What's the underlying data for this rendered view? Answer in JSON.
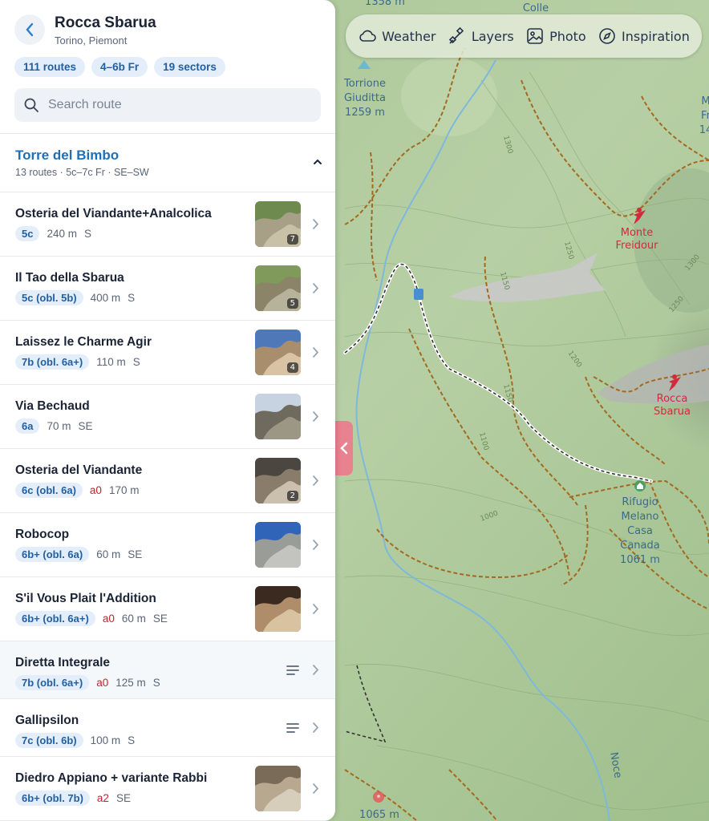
{
  "crag": {
    "title": "Rocca Sbarua",
    "location": "Torino, Piemont",
    "chips": [
      "111 routes",
      "4–6b Fr",
      "19 sectors"
    ]
  },
  "search": {
    "placeholder": "Search route"
  },
  "sector": {
    "title": "Torre del Bimbo",
    "meta": "13 routes · 5c–7c Fr · SE–SW"
  },
  "routes": [
    {
      "name": "Osteria del Viandante+Analcolica",
      "grade": "5c",
      "aid": "",
      "length": "240 m",
      "aspect": "S",
      "photos": "7",
      "kind": "photo"
    },
    {
      "name": "Il Tao della Sbarua",
      "grade": "5c (obl. 5b)",
      "aid": "",
      "length": "400 m",
      "aspect": "S",
      "photos": "5",
      "kind": "photo"
    },
    {
      "name": "Laissez le Charme Agir",
      "grade": "7b (obl. 6a+)",
      "aid": "",
      "length": "110 m",
      "aspect": "S",
      "photos": "4",
      "kind": "photo"
    },
    {
      "name": "Via Bechaud",
      "grade": "6a",
      "aid": "",
      "length": "70 m",
      "aspect": "SE",
      "photos": "",
      "kind": "photo"
    },
    {
      "name": "Osteria del Viandante",
      "grade": "6c (obl. 6a)",
      "aid": "a0",
      "length": "170 m",
      "aspect": "",
      "photos": "2",
      "kind": "photo"
    },
    {
      "name": "Robocop",
      "grade": "6b+ (obl. 6a)",
      "aid": "",
      "length": "60 m",
      "aspect": "SE",
      "photos": "",
      "kind": "photo"
    },
    {
      "name": "S'il Vous Plait l'Addition",
      "grade": "6b+ (obl. 6a+)",
      "aid": "a0",
      "length": "60 m",
      "aspect": "SE",
      "photos": "",
      "kind": "photo"
    },
    {
      "name": "Diretta Integrale",
      "grade": "7b (obl. 6a+)",
      "aid": "a0",
      "length": "125 m",
      "aspect": "S",
      "photos": "",
      "kind": "topo"
    },
    {
      "name": "Gallipsilon",
      "grade": "7c (obl. 6b)",
      "aid": "",
      "length": "100 m",
      "aspect": "S",
      "photos": "",
      "kind": "topo"
    },
    {
      "name": "Diedro Appiano + variante Rabbi",
      "grade": "6b+ (obl. 7b)",
      "aid": "a2",
      "length": "",
      "aspect": "SE",
      "photos": "",
      "kind": "photo"
    }
  ],
  "toolbar": {
    "weather": "Weather",
    "layers": "Layers",
    "photo": "Photo",
    "inspiration": "Inspiration"
  },
  "map": {
    "labels": {
      "top_elev": "1358 m",
      "colle": "Colle",
      "torrione_1": "Torrione",
      "torrione_2": "Giuditta",
      "torrione_3": "1259 m",
      "monte_1": "Monte",
      "monte_2": "Freidour",
      "rocca_1": "Rocca",
      "rocca_2": "Sbarua",
      "rifugio_1": "Rifugio",
      "rifugio_2": "Melano",
      "rifugio_3": "Casa",
      "rifugio_4": "Canada",
      "rifugio_5": "1061 m",
      "bottom_elev": "1065 m",
      "edge_1": "M",
      "edge_2": "Fr",
      "edge_3": "14",
      "stream": "Noce"
    },
    "contours": [
      "1300",
      "1250",
      "1150",
      "1250",
      "1200",
      "1250",
      "1200",
      "1150",
      "1100",
      "1000",
      "1300"
    ]
  },
  "colors": {
    "accent": "#1f6fb8",
    "aid": "#c8202f",
    "chip_bg": "#e4eefa",
    "handle": "#e8828f"
  }
}
